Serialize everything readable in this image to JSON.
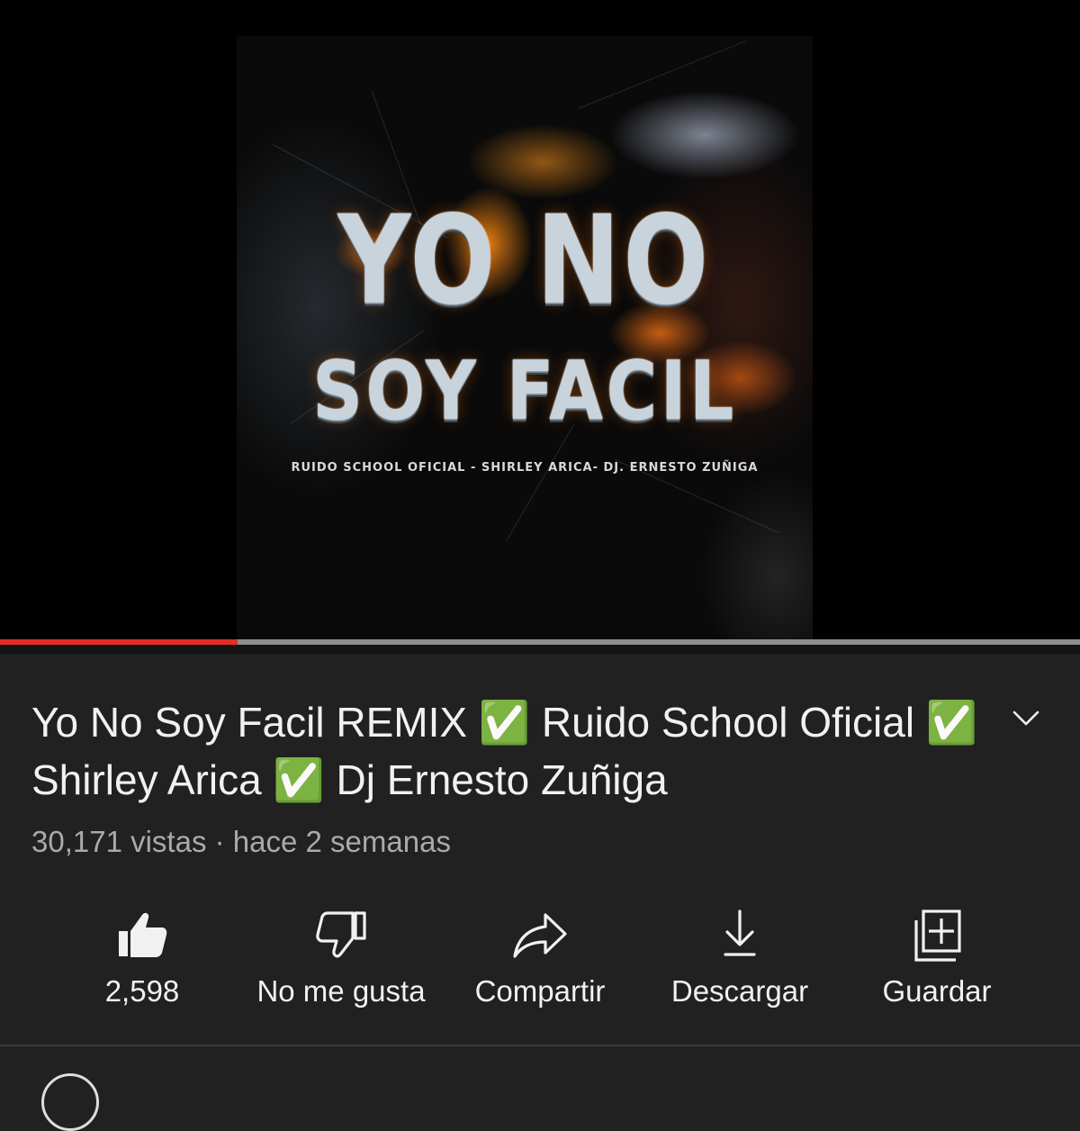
{
  "player": {
    "artwork": {
      "title_line1": "YO NO",
      "title_line2": "SOY FACIL",
      "credits": "RUIDO SCHOOL OFICIAL  - SHIRLEY ARICA- DJ. ERNESTO ZUÑIGA"
    },
    "progress_fraction": 0.22,
    "progress_color": "#e52d27"
  },
  "video": {
    "title": "Yo No Soy Facil REMIX ✅ Ruido School Oficial ✅ Shirley Arica ✅ Dj Ernesto Zuñiga",
    "views": "30,171 vistas",
    "separator": " · ",
    "age": "hace 2 semanas"
  },
  "actions": [
    {
      "icon": "thumbs-up-icon",
      "label": "2,598"
    },
    {
      "icon": "thumbs-down-icon",
      "label": "No me gusta"
    },
    {
      "icon": "share-icon",
      "label": "Compartir"
    },
    {
      "icon": "download-icon",
      "label": "Descargar"
    },
    {
      "icon": "save-to-playlist-icon",
      "label": "Guardar"
    }
  ]
}
